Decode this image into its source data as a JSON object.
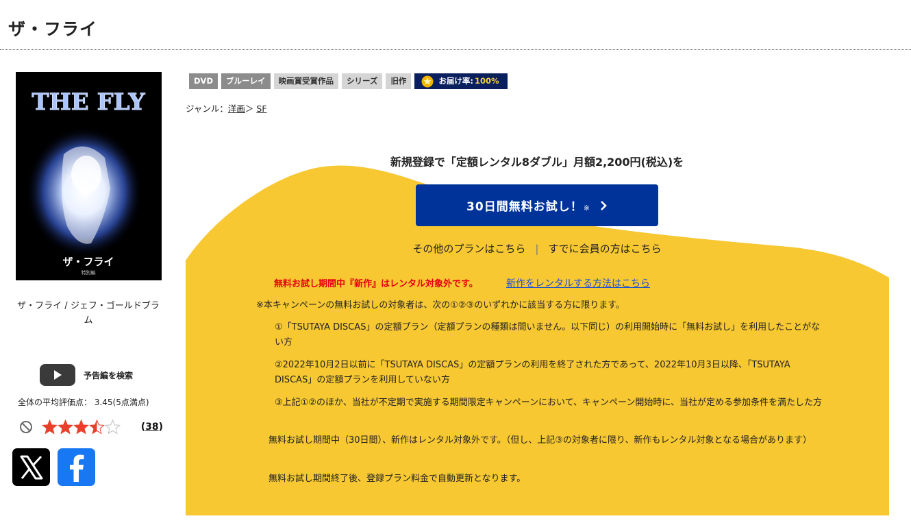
{
  "page": {
    "title": "ザ・フライ"
  },
  "cover": {
    "title_text": "THE FLY",
    "jp_title": "ザ・フライ",
    "jp_subtitle": "特別編"
  },
  "caption": {
    "text": "ザ・フライ / ジェフ・ゴールドブラム"
  },
  "trailer": {
    "icon": "play-icon",
    "label": "予告編を検索"
  },
  "rating": {
    "average_text": "全体の平均評価点： 3.45(5点満点)",
    "average_value": 3.45,
    "max": 5,
    "review_count": "38",
    "icons": {
      "none": "no-rating-icon",
      "star": "star-icon"
    },
    "colors": {
      "star_filled": "#e8402a",
      "star_empty": "#bdbdbd"
    }
  },
  "sns": {
    "x": "x-logo-icon",
    "facebook": "facebook-logo-icon"
  },
  "tags": [
    {
      "label": "DVD",
      "style": "dark"
    },
    {
      "label": "ブルーレイ",
      "style": "dark"
    },
    {
      "label": "映画賞受賞作品",
      "style": "light"
    },
    {
      "label": "シリーズ",
      "style": "light"
    },
    {
      "label": "旧作",
      "style": "light"
    }
  ],
  "delivery": {
    "label": "お届け率:",
    "value": "100%"
  },
  "genre": {
    "label": "ジャンル：",
    "sep": "＞",
    "items": [
      "洋画",
      "SF"
    ]
  },
  "promo": {
    "headline": "新規登録で「定額レンタル8ダブル」月額2,200円(税込)を",
    "button_label": "30日間無料お試し！",
    "button_note": "※",
    "other_plans": "その他のプランはこちら",
    "members": "すでに会員の方はこちら",
    "colors": {
      "background": "#f7c832",
      "button": "#003399",
      "notice": "#e60012"
    }
  },
  "conditions": {
    "notice": "無料お試し期間中『新作』はレンタル対象外です。",
    "notice_link": "新作をレンタルする方法はこちら",
    "intro": "※本キャンペーンの無料お試しの対象者は、次の①②③のいずれかに該当する方に限ります。",
    "items": [
      "①「TSUTAYA DISCAS」の定額プラン（定額プランの種類は問いません。以下同じ）の利用開始時に「無料お試し」を利用したことがない方",
      "②2022年10月2日以前に「TSUTAYA DISCAS」の定額プランの利用を終了された方であって、2022年10月3日以降、「TSUTAYA DISCAS」の定額プランを利用していない方",
      "③上記①②のほか、当社が不定期で実施する期間限定キャンペーンにおいて、キャンペーン開始時に、当社が定める参加条件を満たした方"
    ],
    "footnotes": [
      "無料お試し期間中（30日間）、新作はレンタル対象外です。（但し、上記③の対象者に限り、新作もレンタル対象となる場合があります）",
      "無料お試し期間終了後、登録プラン料金で自動更新となります。"
    ]
  }
}
